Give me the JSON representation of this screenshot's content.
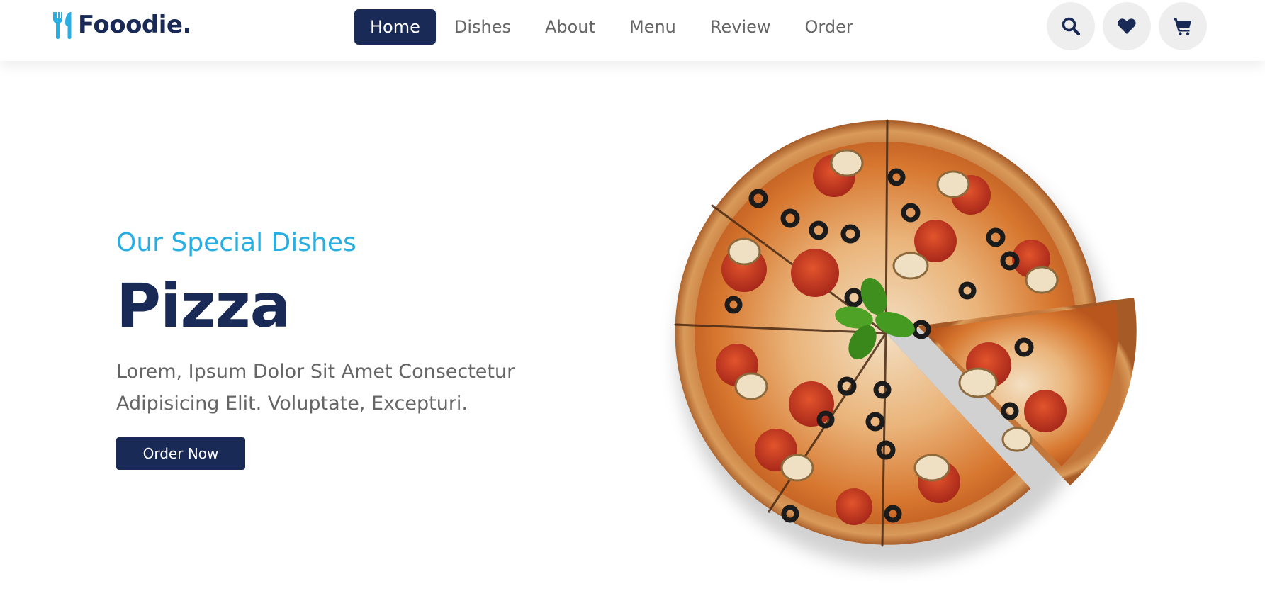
{
  "brand": {
    "name": "Fooodie.",
    "logo_icon": "fork-spoon-icon",
    "accent_color": "#27aee2",
    "primary_color": "#192a56"
  },
  "nav": {
    "items": [
      {
        "label": "Home",
        "active": true
      },
      {
        "label": "Dishes",
        "active": false
      },
      {
        "label": "About",
        "active": false
      },
      {
        "label": "Menu",
        "active": false
      },
      {
        "label": "Review",
        "active": false
      },
      {
        "label": "Order",
        "active": false
      }
    ]
  },
  "actions": [
    {
      "icon": "search-icon"
    },
    {
      "icon": "heart-icon"
    },
    {
      "icon": "cart-icon"
    }
  ],
  "hero": {
    "subtitle": "Our Special Dishes",
    "title": "Pizza",
    "description": "Lorem, Ipsum Dolor Sit Amet Consectetur Adipisicing Elit. Voluptate, Excepturi.",
    "button_label": "Order Now",
    "image": "pizza-image"
  }
}
